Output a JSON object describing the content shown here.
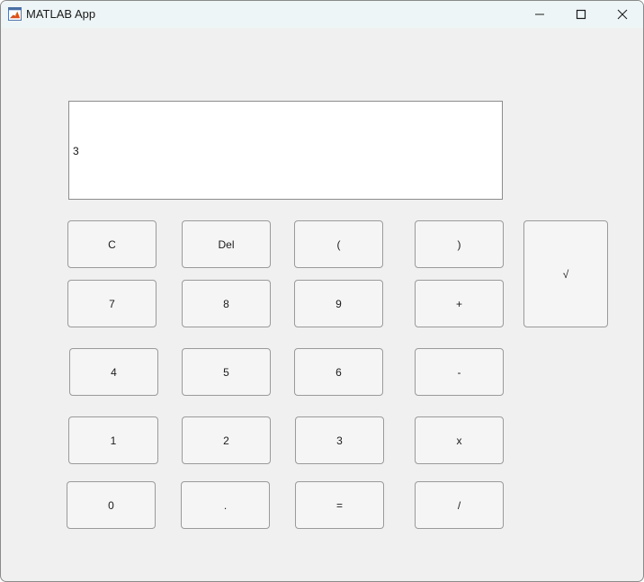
{
  "window": {
    "title": "MATLAB App",
    "controls": {
      "minimize": "minimize-icon",
      "maximize": "maximize-icon",
      "close": "close-icon"
    }
  },
  "display": {
    "value": "3"
  },
  "keys": {
    "clear": "C",
    "delete": "Del",
    "open_paren": "(",
    "close_paren": ")",
    "sqrt": "√",
    "seven": "7",
    "eight": "8",
    "nine": "9",
    "plus": "+",
    "four": "4",
    "five": "5",
    "six": "6",
    "minus": "-",
    "one": "1",
    "two": "2",
    "three": "3",
    "multiply": "x",
    "zero": "0",
    "decimal": ".",
    "equals": "=",
    "divide": "/"
  }
}
